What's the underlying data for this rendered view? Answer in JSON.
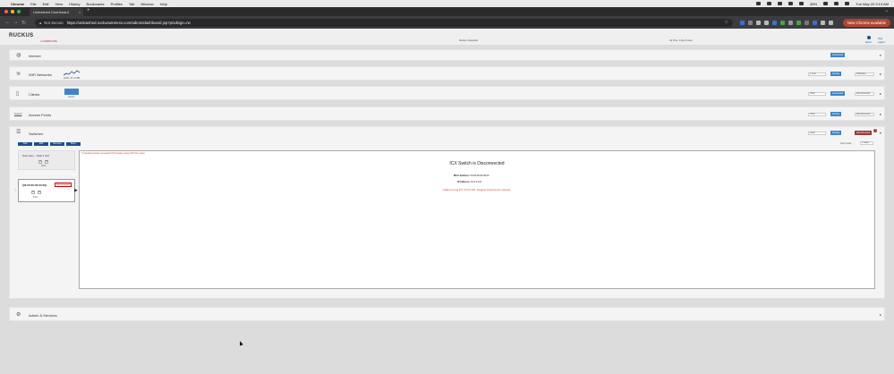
{
  "menubar": {
    "items": [
      "Chrome",
      "File",
      "Edit",
      "View",
      "History",
      "Bookmarks",
      "Profiles",
      "Tab",
      "Window",
      "Help"
    ],
    "battery": "85%",
    "datetime": "Tue May 20 9:13 AM"
  },
  "browser": {
    "tab_title": "Unleashed Dashboard",
    "security": "Not Secure",
    "url": "https://unleashed.ruckuswireless.com/admin/dashboard.jsp?privilege=rw",
    "new_chrome_label": "New Chrome available",
    "colors": {
      "accent": "#b04632"
    }
  },
  "header": {
    "logo": "RUCKUS",
    "logo_sub": "a COMMSCOPE",
    "center_text": "Ruckus Unleashed",
    "right_text": "Up Time: 1 day 2 hours",
    "user_label": "admin",
    "help_label": "Help\nLogout"
  },
  "rows": {
    "internet": {
      "title": "Internet",
      "status": "Connected"
    },
    "wifi": {
      "title": "WiFi Networks",
      "sparkline_label": "traffic: 24.72 MB",
      "period": "1 hour",
      "btn": "Sorting",
      "dropdown": "Database"
    },
    "clients": {
      "title": "Clients",
      "bar_label": "clients",
      "period": "Total",
      "btn": "Connected",
      "dropdown": "Disconnected"
    },
    "access_points": {
      "title": "Access Points",
      "link": "Expand",
      "period": "Total",
      "btn": "Sorting",
      "dropdown": "Disconnected"
    },
    "switches": {
      "title": "Switches",
      "period": "Total",
      "btn": "Sorting",
      "disconnected_btn": "Disconnected",
      "badge": "1",
      "view_mode_label": "View mode",
      "view_mode_value": "1 Value",
      "actions": [
        "Add",
        "Edit",
        "Remove",
        "More"
      ],
      "summary": {
        "title": "Summary - Total 1 ICX",
        "box1": "1",
        "box2": "0",
        "caption": "Ports"
      },
      "device": {
        "mac": "[00:00:00:00:00:00]",
        "status": "Disconnected",
        "box1": "0",
        "box2": "0",
        "caption": "Ports"
      },
      "detail": {
        "warning": "* Unleashed version not support ICX firmware version 08.0.91 or later",
        "title": "ICX Switch is Disconnected",
        "mac_label": "MAC Address:",
        "mac_value": "00:00:00:00:00:00",
        "ip_label": "IP Address:",
        "ip_value": "10.0.0.110",
        "error": "Failed to ping ICX 10.0.0.110. Suggest checking the network."
      }
    },
    "admin": {
      "title": "Admin & Services"
    }
  }
}
